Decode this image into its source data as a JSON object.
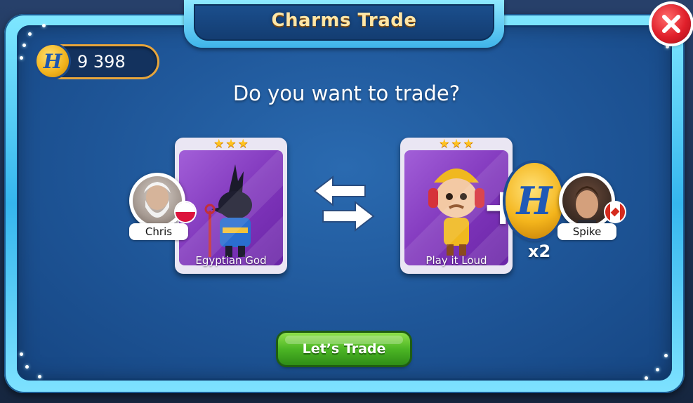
{
  "window": {
    "title": "Charms Trade"
  },
  "balance": {
    "coins": "9 398",
    "icon": "h-coin-icon"
  },
  "prompt": "Do you want to trade?",
  "trade": {
    "left": {
      "player_name": "Chris",
      "player_flag": "poland-flag-icon",
      "card": {
        "stars": 3,
        "name": "Egyptian God"
      }
    },
    "right": {
      "player_name": "Spike",
      "player_flag": "canada-flag-icon",
      "card": {
        "stars": 3,
        "name": "Play it Loud"
      },
      "bonus": {
        "icon": "h-coin-icon",
        "multiplier": "x2"
      }
    },
    "exchange_icon": "swap-arrows-icon"
  },
  "actions": {
    "confirm_label": "Let’s Trade",
    "close_icon": "close-icon"
  },
  "colors": {
    "panel": "#1e5597",
    "frame": "#3fb4ea",
    "card": "#7f35bb",
    "button": "#4cb625",
    "close": "#e01f2a",
    "title_text": "#ffe6a6"
  }
}
